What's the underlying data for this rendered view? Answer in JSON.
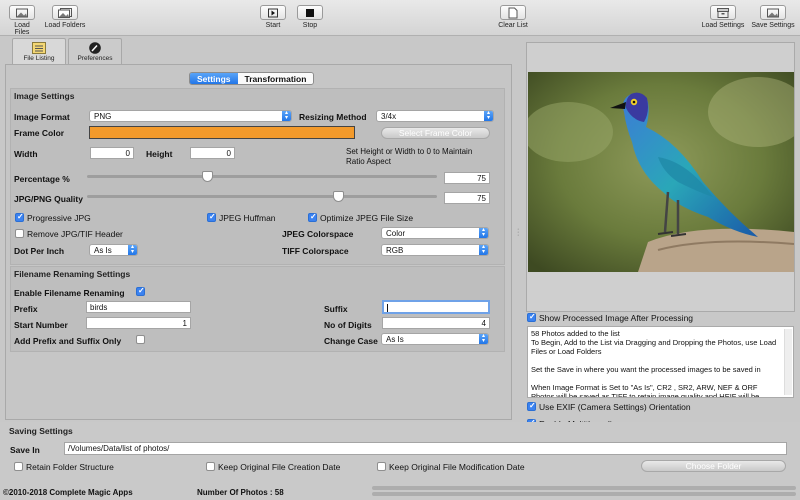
{
  "toolbar": {
    "load_files": "Load Files",
    "load_folders": "Load Folders",
    "start": "Start",
    "stop": "Stop",
    "clear_list": "Clear List",
    "load_settings": "Load Settings",
    "save_settings": "Save Settings"
  },
  "panel_tabs": {
    "file_listing": "File Listing",
    "preferences": "Preferences"
  },
  "segments": {
    "settings": "Settings",
    "transformation": "Transformation"
  },
  "image_settings": {
    "title": "Image Settings",
    "image_format_label": "Image Format",
    "image_format_value": "PNG",
    "resizing_method_label": "Resizing Method",
    "resizing_method_value": "3/4x",
    "frame_color_label": "Frame Color",
    "frame_color_hex": "#f39a2b",
    "select_frame_color": "Select Frame Color",
    "width_label": "Width",
    "width_value": "0",
    "height_label": "Height",
    "height_value": "0",
    "ratio_note": "Set Height or Width to 0 to Maintain\nRatio Aspect",
    "percentage_label": "Percentage %",
    "percentage_value": "75",
    "percentage_level": 75,
    "quality_label": "JPG/PNG Quality",
    "quality_value": "75",
    "quality_level": 75,
    "progressive_jpg": "Progressive JPG",
    "progressive_jpg_checked": true,
    "jpeg_huffman": "JPEG Huffman",
    "jpeg_huffman_checked": true,
    "optimize_jpeg": "Optimize JPEG File Size",
    "optimize_jpeg_checked": true,
    "remove_header": "Remove JPG/TIF Header",
    "remove_header_checked": false,
    "jpeg_colorspace_label": "JPEG Colorspace",
    "jpeg_colorspace_value": "Color",
    "dpi_label": "Dot Per Inch",
    "dpi_value": "As Is",
    "tiff_colorspace_label": "TIFF Colorspace",
    "tiff_colorspace_value": "RGB"
  },
  "renaming": {
    "title": "Filename Renaming Settings",
    "enable_label": "Enable Filename Renaming",
    "enable_checked": true,
    "prefix_label": "Prefix",
    "prefix_value": "birds",
    "suffix_label": "Suffix",
    "suffix_value": "",
    "start_number_label": "Start Number",
    "start_number_value": "1",
    "digits_label": "No of Digits",
    "digits_value": "4",
    "add_prefix_suffix_only": "Add Prefix and Suffix Only",
    "add_prefix_suffix_only_checked": false,
    "change_case_label": "Change Case",
    "change_case_value": "As Is"
  },
  "right": {
    "show_processed": "Show Processed Image After Processing",
    "show_processed_checked": true,
    "info_text": "58 Photos added to the list\nTo Begin, Add to the List via Dragging and Dropping the Photos, use Load Files or Load Folders\n\nSet the Save in where you want the processed images to be saved in\n\nWhen Image Format is Set to \"As Is\", CR2 , SR2, ARW, NEF & ORF Photos will be saved as TIFF to retain image quality and HEIF will be saved as JPG",
    "use_exif": "Use EXIF (Camera Settings) Orientation",
    "use_exif_checked": true,
    "multithreading": "Enable Multithreading",
    "multithreading_checked": true
  },
  "saving": {
    "title": "Saving Settings",
    "save_in_label": "Save In",
    "save_in_value": "/Volumes/Data/list of photos/",
    "retain_structure": "Retain Folder Structure",
    "keep_creation": "Keep Original File Creation Date",
    "keep_modification": "Keep Original File Modification Date",
    "choose_folder": "Choose Folder"
  },
  "status": {
    "copyright": "©2010-2018 Complete Magic Apps",
    "photo_count": "Number Of Photos : 58"
  },
  "colors": {
    "accent": "#2276e8",
    "frame": "#f39a2b"
  }
}
